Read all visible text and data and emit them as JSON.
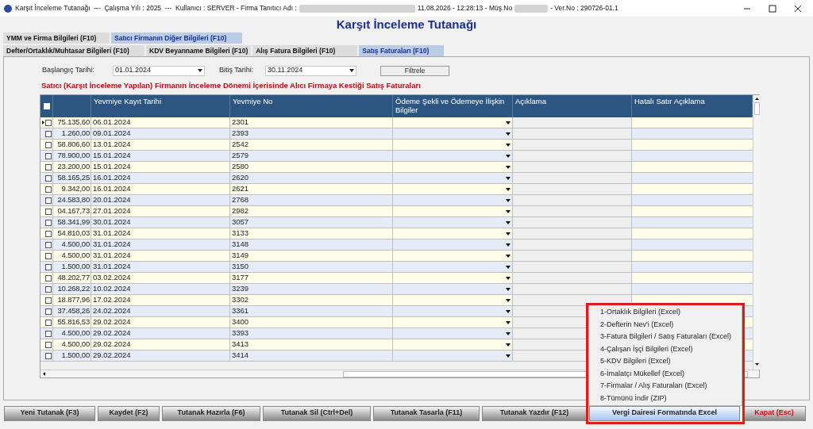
{
  "window": {
    "title_segments": [
      {
        "kind": "text",
        "text": "Karşıt İnceleme Tutanağı  ---  Çalışma Yılı : 2025  ---  Kullanıcı : SERVER - Firma Tanıtıcı Adı :"
      },
      {
        "kind": "redacted"
      },
      {
        "kind": "text",
        "text": "11.08.2026 - 12:28:13 - Müş.No"
      },
      {
        "kind": "redacted"
      },
      {
        "kind": "text",
        "text": "- Ver.No : 290726-01.1"
      }
    ]
  },
  "heading": "Karşıt İnceleme Tutanağı",
  "tab_rows": [
    [
      {
        "label": "YMM ve Firma Bilgileri (F10)",
        "selected": false
      },
      {
        "label": "Satıcı Firmanın Diğer Bilgileri (F10)",
        "selected": true
      }
    ],
    [
      {
        "label": "Defter/Ortaklık/Muhtasar Bilgileri (F10)",
        "selected": false
      },
      {
        "label": "KDV Beyanname Bilgileri (F10)",
        "selected": false
      },
      {
        "label": "Alış Fatura Bilgileri (F10)",
        "selected": false
      },
      {
        "label": "Satış Faturaları (F10)",
        "selected": true
      }
    ]
  ],
  "start_date": {
    "label": "Başlangıç Tarihi:",
    "value": "01.01.2024"
  },
  "end_date": {
    "label": "Bitiş Tarihi:",
    "value": "30.11.2024"
  },
  "filter_button": "Filtrele",
  "section_title": "Satıcı (Karşıt İnceleme Yapılan) Firmanın İnceleme Dönemi İçerisinde Alıcı Firmaya Kestiği Satış Faturaları",
  "table": {
    "select_all_checked": false,
    "columns": [
      "Yevmiye Kayıt Tarihi",
      "Yevmiye No",
      "Ödeme Şekli ve Ödemeye İlişkin Bilgiler",
      "Açıklama",
      "Hatalı Satır Açıklama"
    ],
    "rows": [
      {
        "current": true,
        "checked": false,
        "amount": "75.135,60",
        "date": "06.01.2024",
        "no": "2301"
      },
      {
        "current": false,
        "checked": false,
        "amount": "1.260,00",
        "date": "09.01.2024",
        "no": "2393"
      },
      {
        "current": false,
        "checked": false,
        "amount": "58.806,60",
        "date": "13.01.2024",
        "no": "2542"
      },
      {
        "current": false,
        "checked": false,
        "amount": "78.900,00",
        "date": "15.01.2024",
        "no": "2579"
      },
      {
        "current": false,
        "checked": false,
        "amount": "23.200,00",
        "date": "15.01.2024",
        "no": "2580"
      },
      {
        "current": false,
        "checked": false,
        "amount": "58.165,25",
        "date": "16.01.2024",
        "no": "2620"
      },
      {
        "current": false,
        "checked": false,
        "amount": "9.342,00",
        "date": "16.01.2024",
        "no": "2621"
      },
      {
        "current": false,
        "checked": false,
        "amount": "24.583,80",
        "date": "20.01.2024",
        "no": "2768"
      },
      {
        "current": false,
        "checked": false,
        "amount": "04.167,73",
        "date": "27.01.2024",
        "no": "2982"
      },
      {
        "current": false,
        "checked": false,
        "amount": "58.341,99",
        "date": "30.01.2024",
        "no": "3057"
      },
      {
        "current": false,
        "checked": false,
        "amount": "54.810,03",
        "date": "31.01.2024",
        "no": "3133"
      },
      {
        "current": false,
        "checked": false,
        "amount": "4.500,00",
        "date": "31.01.2024",
        "no": "3148"
      },
      {
        "current": false,
        "checked": false,
        "amount": "4.500,00",
        "date": "31.01.2024",
        "no": "3149"
      },
      {
        "current": false,
        "checked": false,
        "amount": "1.500,00",
        "date": "31.01.2024",
        "no": "3150"
      },
      {
        "current": false,
        "checked": false,
        "amount": "48.202,77",
        "date": "03.02.2024",
        "no": "3177"
      },
      {
        "current": false,
        "checked": false,
        "amount": "10.268,22",
        "date": "10.02.2024",
        "no": "3239"
      },
      {
        "current": false,
        "checked": false,
        "amount": "18.877,96",
        "date": "17.02.2024",
        "no": "3302"
      },
      {
        "current": false,
        "checked": false,
        "amount": "37.458,26",
        "date": "24.02.2024",
        "no": "3361"
      },
      {
        "current": false,
        "checked": false,
        "amount": "55.816,53",
        "date": "29.02.2024",
        "no": "3400"
      },
      {
        "current": false,
        "checked": false,
        "amount": "4.500,00",
        "date": "29.02.2024",
        "no": "3393"
      },
      {
        "current": false,
        "checked": false,
        "amount": "4.500,00",
        "date": "29.02.2024",
        "no": "3413"
      },
      {
        "current": false,
        "checked": false,
        "amount": "1.500,00",
        "date": "29.02.2024",
        "no": "3414"
      }
    ]
  },
  "export_menu": [
    "1-Ortaklık Bilgileri (Excel)",
    "2-Defterin Nev'i (Excel)",
    "3-Fatura Bilgileri / Satış Faturaları (Excel)",
    "4-Çalışan İşçi Bilgileri (Excel)",
    "5-KDV Bilgileri (Excel)",
    "6-İmalatçı Mükellef (Excel)",
    "7-Firmalar / Alış Faturaları (Excel)",
    "8-Tümünü İndir (ZIP)"
  ],
  "buttons": [
    {
      "label": "Yeni Tutanak (F3)",
      "kind": "normal",
      "highlighted": false
    },
    {
      "label": "Kaydet (F2)",
      "kind": "normal",
      "highlighted": false
    },
    {
      "label": "Tutanak Hazırla (F6)",
      "kind": "normal",
      "highlighted": false
    },
    {
      "label": "Tutanak Sil (Ctrl+Del)",
      "kind": "normal",
      "highlighted": false
    },
    {
      "label": "Tutanak Tasarla (F11)",
      "kind": "normal",
      "highlighted": false
    },
    {
      "label": "Tutanak Yazdır (F12)",
      "kind": "normal",
      "highlighted": false
    },
    {
      "label": "Vergi Dairesi Formatında Excel",
      "kind": "normal",
      "highlighted": true
    },
    {
      "label": "Kapat (Esc)",
      "kind": "danger",
      "highlighted": false
    }
  ]
}
